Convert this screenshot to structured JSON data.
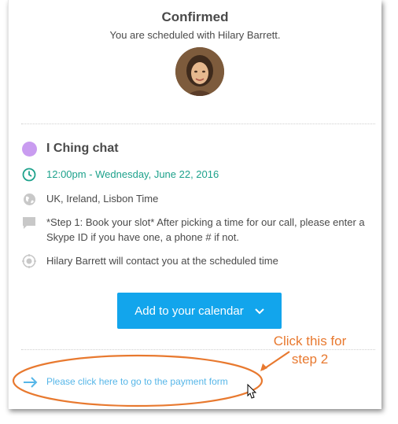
{
  "header": {
    "title": "Confirmed",
    "subtitle": "You are scheduled with Hilary Barrett."
  },
  "event": {
    "name": "I Ching chat",
    "color": "#c99cf0",
    "time": "12:00pm - Wednesday, June 22, 2016",
    "timezone": "UK, Ireland, Lisbon Time",
    "note": "*Step 1: Book your slot* After picking a time for our call, please enter a Skype ID if you have one, a phone # if not.",
    "location": "Hilary Barrett will contact you at the scheduled time"
  },
  "actions": {
    "calendar_button": "Add to your calendar",
    "payment_link": "Please click here to go to the payment form"
  },
  "annotation": {
    "line1": "Click this for",
    "line2": "step 2",
    "color": "#e8792f"
  },
  "colors": {
    "accent": "#12a5ec",
    "time_green": "#1ea28c",
    "link_blue": "#56b6e8"
  }
}
